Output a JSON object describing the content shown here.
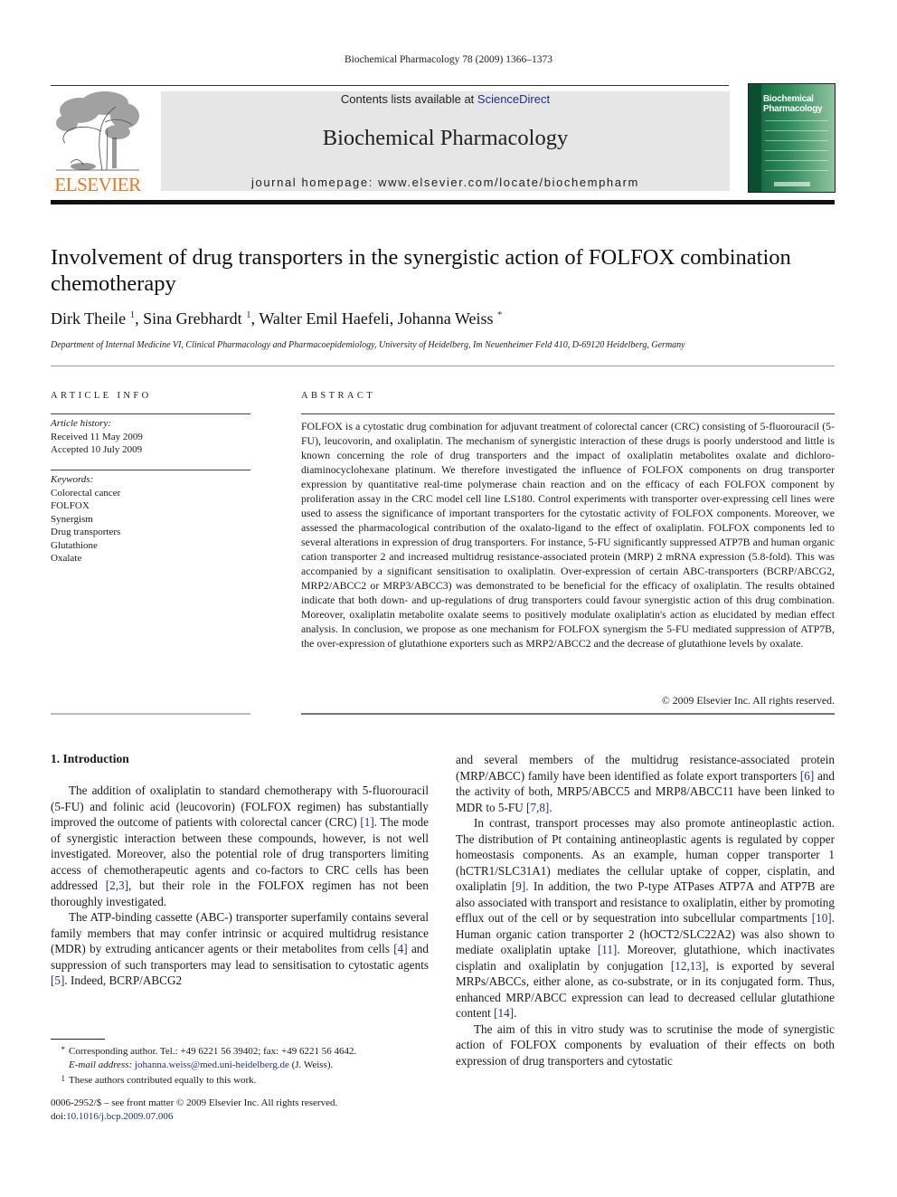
{
  "running_head": "Biochemical Pharmacology 78 (2009) 1366–1373",
  "masthead": {
    "publisher_logo_text": "ELSEVIER",
    "contents_prefix": "Contents lists available at ",
    "contents_link": "ScienceDirect",
    "journal_title": "Biochemical Pharmacology",
    "homepage": "journal homepage: www.elsevier.com/locate/biochempharm",
    "cover_title_line1": "Biochemical",
    "cover_title_line2": "Pharmacology",
    "colors": {
      "publisher_orange": "#e87722",
      "banner_gray": "#e6e6e6",
      "cover_green": "#1f7a4a",
      "link_blue": "#1f2f8c"
    }
  },
  "article": {
    "title": "Involvement of drug transporters in the synergistic action of FOLFOX combination chemotherapy",
    "authors": [
      {
        "name": "Dirk Theile",
        "mark": "1"
      },
      {
        "name": "Sina Grebhardt",
        "mark": "1"
      },
      {
        "name": "Walter Emil Haefeli",
        "mark": ""
      },
      {
        "name": "Johanna Weiss",
        "mark": "*"
      }
    ],
    "affiliation": "Department of Internal Medicine VI, Clinical Pharmacology and Pharmacoepidemiology, University of Heidelberg, Im Neuenheimer Feld 410, D-69120 Heidelberg, Germany"
  },
  "article_info": {
    "heading": "ARTICLE INFO",
    "history_label": "Article history:",
    "received": "Received 11 May 2009",
    "accepted": "Accepted 10 July 2009",
    "keywords_label": "Keywords:",
    "keywords": [
      "Colorectal cancer",
      "FOLFOX",
      "Synergism",
      "Drug transporters",
      "Glutathione",
      "Oxalate"
    ]
  },
  "abstract": {
    "heading": "ABSTRACT",
    "text": "FOLFOX is a cytostatic drug combination for adjuvant treatment of colorectal cancer (CRC) consisting of 5-fluorouracil (5-FU), leucovorin, and oxaliplatin. The mechanism of synergistic interaction of these drugs is poorly understood and little is known concerning the role of drug transporters and the impact of oxaliplatin metabolites oxalate and dichloro-diaminocyclohexane platinum. We therefore investigated the influence of FOLFOX components on drug transporter expression by quantitative real-time polymerase chain reaction and on the efficacy of each FOLFOX component by proliferation assay in the CRC model cell line LS180. Control experiments with transporter over-expressing cell lines were used to assess the significance of important transporters for the cytostatic activity of FOLFOX components. Moreover, we assessed the pharmacological contribution of the oxalato-ligand to the effect of oxaliplatin. FOLFOX components led to several alterations in expression of drug transporters. For instance, 5-FU significantly suppressed ATP7B and human organic cation transporter 2 and increased multidrug resistance-associated protein (MRP) 2 mRNA expression (5.8-fold). This was accompanied by a significant sensitisation to oxaliplatin. Over-expression of certain ABC-transporters (BCRP/ABCG2, MRP2/ABCC2 or MRP3/ABCC3) was demonstrated to be beneficial for the efficacy of oxaliplatin. The results obtained indicate that both down- and up-regulations of drug transporters could favour synergistic action of this drug combination. Moreover, oxaliplatin metabolite oxalate seems to positively modulate oxaliplatin's action as elucidated by median effect analysis. In conclusion, we propose as one mechanism for FOLFOX synergism the 5-FU mediated suppression of ATP7B, the over-expression of glutathione exporters such as MRP2/ABCC2 and the decrease of glutathione levels by oxalate.",
    "copyright": "© 2009 Elsevier Inc. All rights reserved."
  },
  "body": {
    "section_heading": "1.  Introduction",
    "left_paragraphs": [
      [
        {
          "t": "The addition of oxaliplatin to standard chemotherapy with 5-fluorouracil (5-FU) and folinic acid (leucovorin) (FOLFOX regimen) has substantially improved the outcome of patients with colorectal cancer (CRC) "
        },
        {
          "r": "[1]"
        },
        {
          "t": ". The mode of synergistic interaction between these compounds, however, is not well investigated. Moreover, also the potential role of drug transporters limiting access of chemotherapeutic agents and co-factors to CRC cells has been addressed "
        },
        {
          "r": "[2,3]"
        },
        {
          "t": ", but their role in the FOLFOX regimen has not been thoroughly investigated."
        }
      ],
      [
        {
          "t": "The ATP-binding cassette (ABC-) transporter superfamily contains several family members that may confer intrinsic or acquired multidrug resistance (MDR) by extruding anticancer agents or their metabolites from cells "
        },
        {
          "r": "[4]"
        },
        {
          "t": " and suppression of such transporters may lead to sensitisation to cytostatic agents "
        },
        {
          "r": "[5]"
        },
        {
          "t": ". Indeed, BCRP/ABCG2"
        }
      ]
    ],
    "right_paragraphs": [
      [
        {
          "t": "and several members of the multidrug resistance-associated protein (MRP/ABCC) family have been identified as folate export transporters "
        },
        {
          "r": "[6]"
        },
        {
          "t": " and the activity of both, MRP5/ABCC5 and MRP8/ABCC11 have been linked to MDR to 5-FU "
        },
        {
          "r": "[7,8]"
        },
        {
          "t": "."
        }
      ],
      [
        {
          "t": "In contrast, transport processes may also promote antineoplastic action. The distribution of Pt containing antineoplastic agents is regulated by copper homeostasis components. As an example, human copper transporter 1 (hCTR1/SLC31A1) mediates the cellular uptake of copper, cisplatin, and oxaliplatin "
        },
        {
          "r": "[9]"
        },
        {
          "t": ". In addition, the two P-type ATPases ATP7A and ATP7B are also associated with transport and resistance to oxaliplatin, either by promoting efflux out of the cell or by sequestration into subcellular compartments "
        },
        {
          "r": "[10]"
        },
        {
          "t": ". Human organic cation transporter 2 (hOCT2/SLC22A2) was also shown to mediate oxaliplatin uptake "
        },
        {
          "r": "[11]"
        },
        {
          "t": ". Moreover, glutathione, which inactivates cisplatin and oxaliplatin by conjugation "
        },
        {
          "r": "[12,13]"
        },
        {
          "t": ", is exported by several MRPs/ABCCs, either alone, as co-substrate, or in its conjugated form. Thus, enhanced MRP/ABCC expression can lead to decreased cellular glutathione content "
        },
        {
          "r": "[14]"
        },
        {
          "t": "."
        }
      ],
      [
        {
          "t": "The aim of this in vitro study was to scrutinise the mode of synergistic action of FOLFOX components by evaluation of their effects on both expression of drug transporters and cytostatic"
        }
      ]
    ]
  },
  "footnotes": {
    "corresponding_mark": "*",
    "corresponding": "Corresponding author. Tel.: +49 6221 56 39402; fax: +49 6221 56 4642.",
    "email_label": "E-mail address:",
    "email": "johanna.weiss@med.uni-heidelberg.de",
    "email_suffix": " (J. Weiss).",
    "equal_mark": "1",
    "equal": "These authors contributed equally to this work."
  },
  "front_matter": {
    "issn_line": "0006-2952/$ – see front matter © 2009 Elsevier Inc. All rights reserved.",
    "doi_prefix": "doi:",
    "doi": "10.1016/j.bcp.2009.07.006"
  }
}
